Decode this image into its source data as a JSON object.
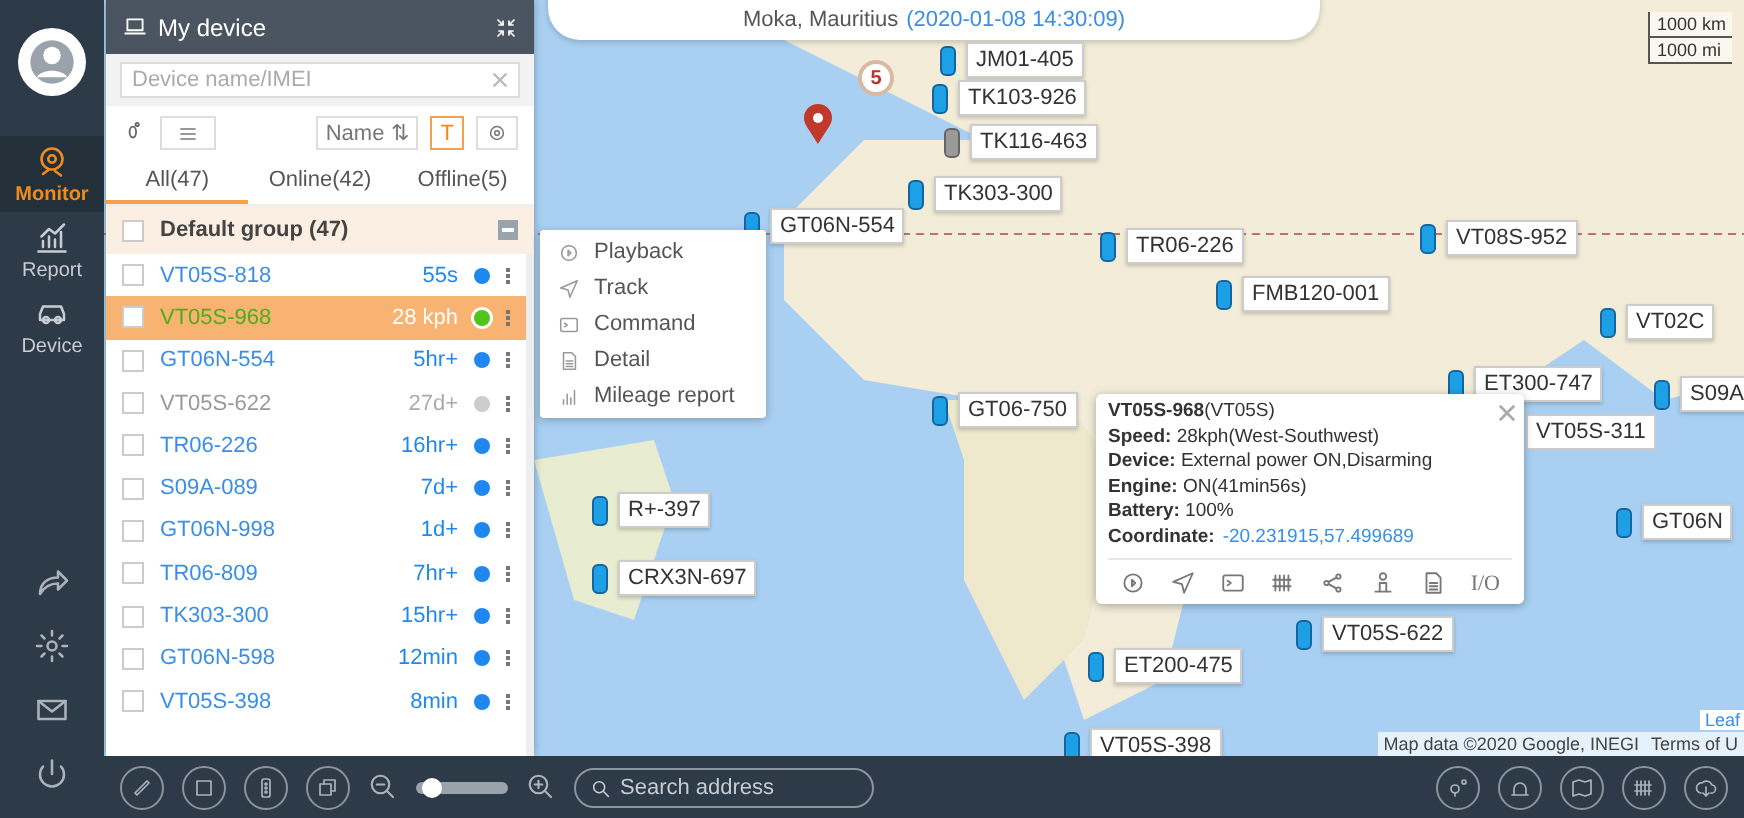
{
  "nav": {
    "items": [
      {
        "label": "Monitor",
        "selected": true
      },
      {
        "label": "Report",
        "selected": false
      },
      {
        "label": "Device",
        "selected": false
      }
    ]
  },
  "address_bar": {
    "place": "Moka, Mauritius",
    "time": "(2020-01-08 14:30:09)"
  },
  "device_panel": {
    "title": "My device",
    "search": {
      "placeholder": "Device name/IMEI"
    },
    "sort_button": "Name ⇅",
    "label_toggle": {
      "label": "T",
      "on": true
    },
    "tabs": [
      {
        "label": "All(47)",
        "selected": true
      },
      {
        "label": "Online(42)",
        "selected": false
      },
      {
        "label": "Offline(5)",
        "selected": false
      }
    ],
    "group": {
      "label": "Default group (47)",
      "checked": false,
      "expanded": true
    },
    "devices": [
      {
        "name": "VT05S-818",
        "status": "55s",
        "online": true,
        "selected": false,
        "checked": false,
        "color": "#1e88f0"
      },
      {
        "name": "VT05S-968",
        "status": "28 kph",
        "online": true,
        "selected": true,
        "checked": false,
        "color": "#52c41a"
      },
      {
        "name": "GT06N-554",
        "status": "5hr+",
        "online": true,
        "selected": false,
        "checked": false,
        "color": "#1e88f0"
      },
      {
        "name": "VT05S-622",
        "status": "27d+",
        "online": false,
        "selected": false,
        "checked": false,
        "color": "#cccccc"
      },
      {
        "name": "TR06-226",
        "status": "16hr+",
        "online": true,
        "selected": false,
        "checked": false,
        "color": "#1e88f0"
      },
      {
        "name": "S09A-089",
        "status": "7d+",
        "online": true,
        "selected": false,
        "checked": false,
        "color": "#1e88f0"
      },
      {
        "name": "GT06N-998",
        "status": "1d+",
        "online": true,
        "selected": false,
        "checked": false,
        "color": "#1e88f0"
      },
      {
        "name": "TR06-809",
        "status": "7hr+",
        "online": true,
        "selected": false,
        "checked": false,
        "color": "#1e88f0"
      },
      {
        "name": "TK303-300",
        "status": "15hr+",
        "online": true,
        "selected": false,
        "checked": false,
        "color": "#1e88f0"
      },
      {
        "name": "GT06N-598",
        "status": "12min",
        "online": true,
        "selected": false,
        "checked": false,
        "color": "#1e88f0"
      },
      {
        "name": "VT05S-398",
        "status": "8min",
        "online": true,
        "selected": false,
        "checked": false,
        "color": "#1e88f0"
      }
    ]
  },
  "context_menu": [
    {
      "label": "Playback"
    },
    {
      "label": "Track"
    },
    {
      "label": "Command"
    },
    {
      "label": "Detail"
    },
    {
      "label": "Mileage report"
    }
  ],
  "map": {
    "scale": [
      "1000 km",
      "1000 mi"
    ],
    "cluster": "5",
    "attribution": "Map data ©2020 Google, INEGI",
    "terms": "Terms of U",
    "leaflet": "Leaf",
    "markers": [
      {
        "label": "JM01-405",
        "moving": true
      },
      {
        "label": "TK103-926",
        "moving": true
      },
      {
        "label": "TK116-463",
        "moving": false
      },
      {
        "label": "TK303-300",
        "moving": true
      },
      {
        "label": "GT06N-554",
        "moving": true
      },
      {
        "label": "TR06-226",
        "moving": true
      },
      {
        "label": "FMB120-001",
        "moving": true
      },
      {
        "label": "VT08S-952",
        "moving": true
      },
      {
        "label": "VT02C",
        "moving": true
      },
      {
        "label": "ET300-747",
        "moving": true
      },
      {
        "label": "S09A",
        "moving": true
      },
      {
        "label": "GT06-750",
        "moving": true
      },
      {
        "label": "GT06N",
        "moving": true
      },
      {
        "label": "R+-397",
        "moving": true
      },
      {
        "label": "CRX3N-697",
        "moving": true
      },
      {
        "label": "ET200-475",
        "moving": true
      },
      {
        "label": "VT05S-622",
        "moving": true
      },
      {
        "label": "VT05S-398",
        "moving": true
      }
    ],
    "hidden_label": "VT05S-311"
  },
  "popup": {
    "title": "**VT05S-968**(VT05S)",
    "lines": [
      "**Speed:** 28kph(West-Southwest)",
      "**Device:** External power ON,Disarming",
      "**Engine:** ON(41min56s)",
      "**Battery:** 100%"
    ],
    "coordinate_label": "Coordinate:",
    "coordinate": "-20.231915,57.499689",
    "io": "I/O"
  },
  "bottom_bar": {
    "zoom": {
      "level": 0.1
    },
    "search": {
      "placeholder": "Search address"
    }
  }
}
